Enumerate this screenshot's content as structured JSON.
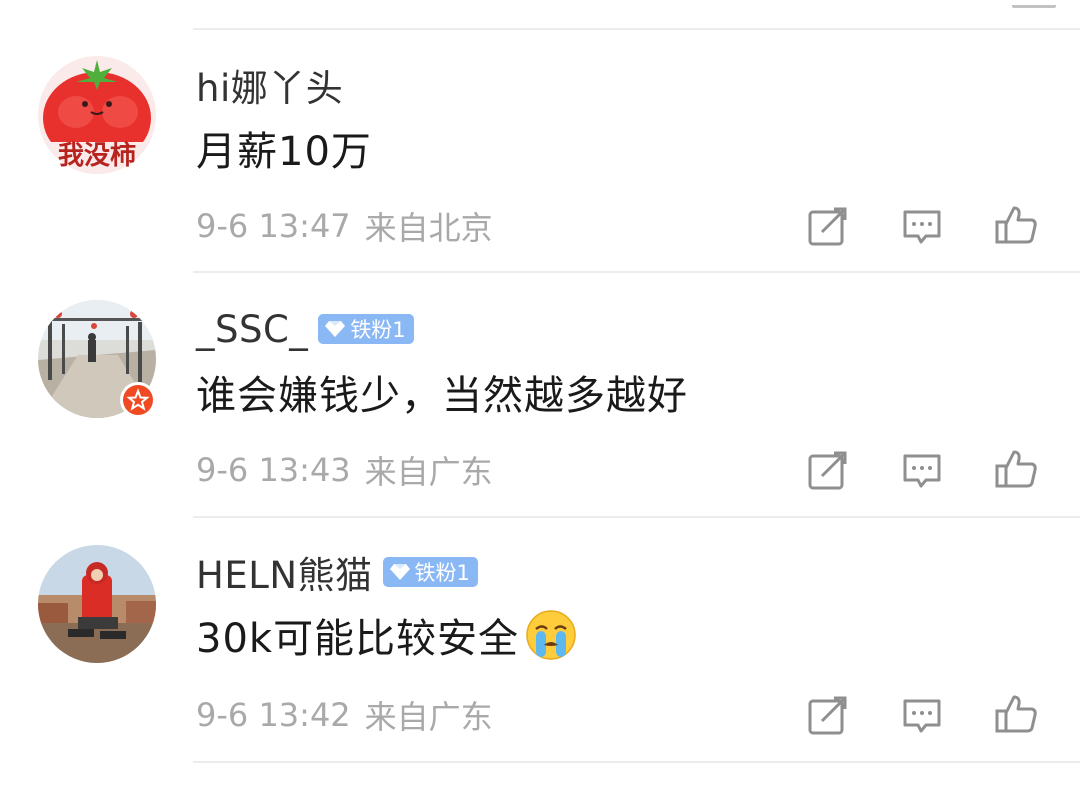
{
  "comments": [
    {
      "username": "hi娜丫头",
      "badge": null,
      "text": "月薪10万",
      "date": "9-6 13:47",
      "location": "来自北京",
      "avatar_text": "我没柿"
    },
    {
      "username": "_SSC_",
      "badge": "铁粉1",
      "text": "谁会嫌钱少，当然越多越好",
      "date": "9-6 13:43",
      "location": "来自广东"
    },
    {
      "username": "HELN熊猫",
      "badge": "铁粉1",
      "text": "30k可能比较安全",
      "date": "9-6 13:42",
      "location": "来自广东"
    }
  ],
  "icons": {
    "repost": "repost-icon",
    "comment": "comment-icon",
    "like": "like-icon",
    "badge": "diamond-icon",
    "emoji": "crying-emoji-icon"
  },
  "colors": {
    "meta_text": "#a9a9a9",
    "badge_bg": "#8ab8f5",
    "divider": "#ececec"
  }
}
